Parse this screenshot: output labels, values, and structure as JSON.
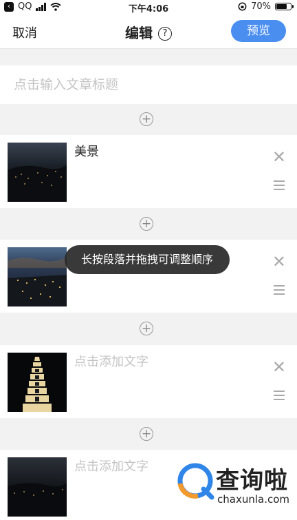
{
  "status_bar": {
    "app": "QQ",
    "time": "下午4:06",
    "battery": "70%"
  },
  "nav": {
    "cancel_label": "取消",
    "title": "编辑",
    "help_glyph": "?",
    "preview_label": "预览"
  },
  "title_input": {
    "placeholder": "点击输入文章标题",
    "value": ""
  },
  "blocks": [
    {
      "text": "美景",
      "is_placeholder": false
    },
    {
      "text": "",
      "is_placeholder": true
    },
    {
      "text": "点击添加文字",
      "is_placeholder": true
    },
    {
      "text": "点击添加文字",
      "is_placeholder": true
    }
  ],
  "toast": {
    "text": "长按段落并拖拽可调整顺序"
  },
  "watermark": {
    "cn": "查询啦",
    "en": "chaxunla.com"
  },
  "icons": {
    "add": "plus-circle-icon",
    "remove": "close-icon",
    "reorder": "drag-handle-icon",
    "help": "question-circle-icon"
  },
  "colors": {
    "accent": "#4a8ef0",
    "placeholder": "#c4c4c4",
    "background": "#f2f2f2"
  }
}
